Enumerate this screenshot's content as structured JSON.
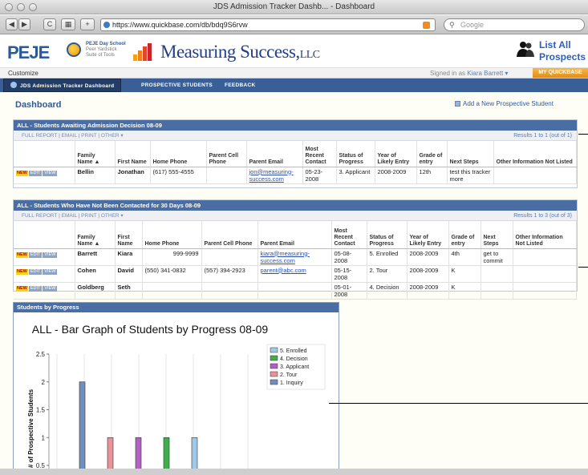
{
  "window": {
    "title": "JDS Admission Tracker Dashb... - Dashboard"
  },
  "browser": {
    "url": "https://www.quickbase.com/db/bdq9S6rvw",
    "search_placeholder": "Google",
    "nav": [
      "◀",
      "▶",
      "C",
      "▦",
      "+"
    ]
  },
  "header": {
    "peje_logo": "PEJE",
    "peje_line1": "PEJE Day School",
    "peje_line2": "Peer Yardstick",
    "peje_line3": "Suite of Tools",
    "ms_logo": "Measuring Success,",
    "ms_llc": "LLC",
    "list_all_1": "List All",
    "list_all_2": "Prospects"
  },
  "userbar": {
    "customize": "Customize",
    "signed_in_prefix": "Signed in as",
    "user": "Kiara Barrett ▾",
    "my_quickbase": "MY QUICKBASE"
  },
  "tabs": [
    {
      "label": "JDS Admission Tracker Dashboard"
    },
    {
      "label": "PROSPECTIVE STUDENTS"
    },
    {
      "label": "FEEDBACK"
    }
  ],
  "dashboard": {
    "title": "Dashboard",
    "add_link": "Add a New Prospective Student"
  },
  "table1": {
    "title": "ALL - Students Awaiting Admission Decision 08-09",
    "tools": "FULL REPORT  |  EMAIL  |  PRINT  |  OTHER ▾",
    "results": "Results 1 to 1 (out of 1)",
    "headers": [
      "",
      "Family Name",
      "First Name",
      "Home Phone",
      "Parent Cell Phone",
      "Parent Email",
      "Most Recent Contact",
      "Status of Progress",
      "Year of Likely Entry",
      "Grade of entry",
      "Next Steps",
      "Other Information Not Listed"
    ],
    "rows": [
      {
        "family": "Bellin",
        "first": "Jonathan",
        "home": "(617) 555-4555",
        "cell": "",
        "email": "jon@measuring-success.com",
        "contact": "05-23-2008",
        "status": "3. Applicant",
        "year": "2008-2009",
        "grade": "12th",
        "next": "test this tracker more",
        "other": ""
      }
    ]
  },
  "table2": {
    "title": "ALL - Students Who Have Not Been Contacted for 30 Days 08-09",
    "tools": "FULL REPORT  |  EMAIL  |  PRINT  |  OTHER ▾",
    "results": "Results 1 to 3 (out of 3)",
    "headers": [
      "",
      "Family Name",
      "First Name",
      "Home Phone",
      "Parent Cell Phone",
      "Parent Email",
      "Most Recent Contact",
      "Status of Progress",
      "Year of Likely Entry",
      "Grade of entry",
      "Next Steps",
      "Other Information Not Listed"
    ],
    "rows": [
      {
        "family": "Barrett",
        "first": "Kiara",
        "home": "999-9999",
        "cell": "",
        "email": "kiara@measuring-success.com",
        "contact": "05-08-2008",
        "status": "5. Enrolled",
        "year": "2008-2009",
        "grade": "4th",
        "next": "get to commit",
        "other": ""
      },
      {
        "family": "Cohen",
        "first": "David",
        "home": "(550) 341-0832",
        "cell": "(557) 394-2923",
        "email": "parent@abc.com",
        "contact": "05-15-2008",
        "status": "2. Tour",
        "year": "2008-2009",
        "grade": "K",
        "next": "",
        "other": ""
      },
      {
        "family": "Goldberg",
        "first": "Seth",
        "home": "",
        "cell": "",
        "email": "",
        "contact": "05-01-2008",
        "status": "4. Decision",
        "year": "2008-2009",
        "grade": "K",
        "next": "",
        "other": ""
      }
    ],
    "badges": {
      "new": "NEW",
      "edit": "EDIT",
      "view": "VIEW"
    }
  },
  "chart_panel_title": "Students by Progress",
  "chart_data": {
    "type": "bar",
    "title": "ALL - Bar Graph of Students by Progress 08-09",
    "ylabel": "# of Prospective Students",
    "ylim": [
      0.5,
      2.5
    ],
    "yticks": [
      "2.5",
      "2",
      "1.5",
      "1",
      "0.5"
    ],
    "series": [
      {
        "name": "1. Inquiry",
        "value": 2,
        "color": "#6f8fbf"
      },
      {
        "name": "2. Tour",
        "value": 1,
        "color": "#e8939a"
      },
      {
        "name": "3. Applicant",
        "value": 1,
        "color": "#b45fc4"
      },
      {
        "name": "4. Decision",
        "value": 1,
        "color": "#3fae4c"
      },
      {
        "name": "5. Enrolled",
        "value": 1,
        "color": "#9fc9e8"
      }
    ],
    "legend_order": [
      "5. Enrolled",
      "4. Decision",
      "3. Applicant",
      "2. Tour",
      "1. Inquiry"
    ],
    "legend_placement": "top-right",
    "grid": true
  }
}
